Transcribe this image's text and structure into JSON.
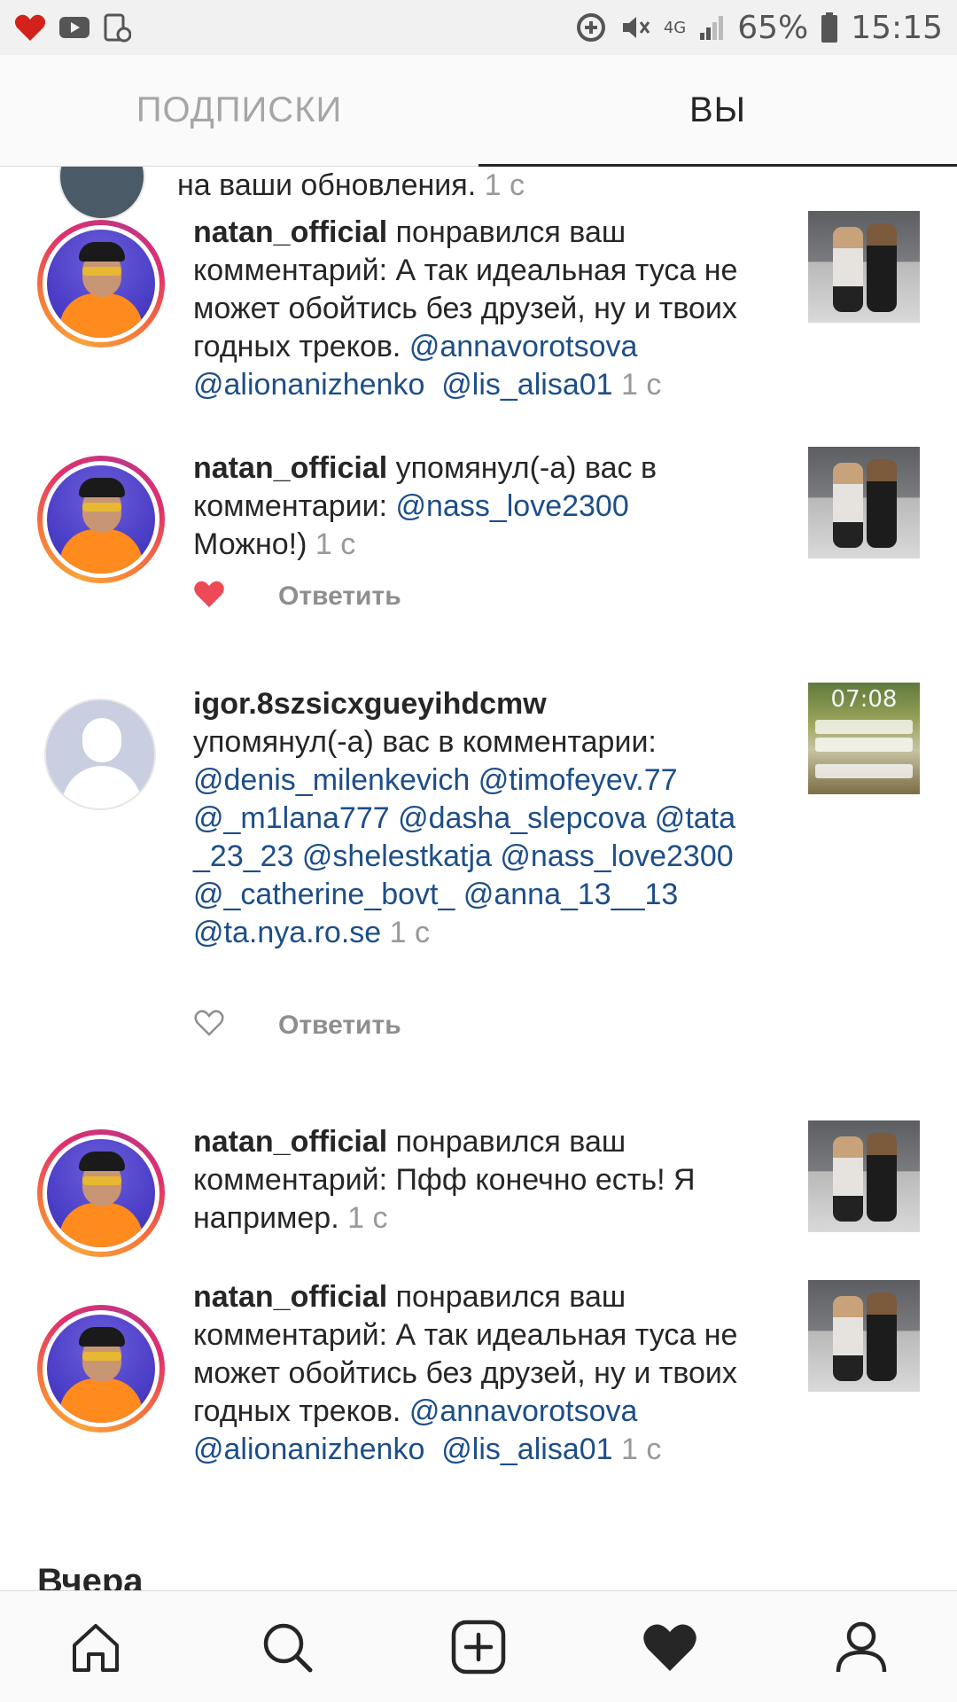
{
  "status_bar": {
    "battery": "65%",
    "time": "15:15",
    "network": "4G",
    "icons": [
      "heart-icon",
      "youtube-icon",
      "clipboard-icon",
      "data-saver-icon",
      "mute-icon",
      "signal-icon",
      "battery-icon"
    ]
  },
  "tabs": {
    "following": "ПОДПИСКИ",
    "you": "ВЫ",
    "active": "you"
  },
  "partial_top": {
    "text": "на ваши обновления.",
    "time": "1 с"
  },
  "items": [
    {
      "username": "natan_official",
      "action": " понравился ваш комментарий: А так идеальная туса не может обойтись без друзей, ну и твоих годных треков. ",
      "mention1": "@annavorotsova",
      "mention2": "@alionanizhenko",
      "mention3": "@lis_alisa01",
      "time": "1 с"
    },
    {
      "username": "natan_official",
      "action": " упомянул(-а) вас в комментарии: ",
      "mention1": "@nass_love2300",
      "after": "Можно!)",
      "time": "1 с",
      "reply": "Ответить",
      "liked": true
    },
    {
      "username": "igor.8szsicxgueyihdcmw",
      "action": "упомянул(-а) вас в комментарии:",
      "mentions_line1": "@denis_milenkevich @timofeyev.77",
      "mentions_line2": "@_m1lana777 @dasha_slepcova @tata",
      "mentions_line3": "_23_23 @shelestkatja @nass_love2300",
      "mentions_line4": "@_catherine_bovt_ @anna_13__13",
      "mentions_line5": "@ta.nya.ro.se",
      "time": "1 с",
      "reply": "Ответить",
      "liked": false,
      "thumb_clock": "07:08"
    },
    {
      "username": "natan_official",
      "action": " понравился ваш комментарий: Пфф конечно есть! Я например. ",
      "time": "1 с"
    },
    {
      "username": "natan_official",
      "action": " понравился ваш комментарий: А так идеальная туса не может обойтись без друзей, ну и твоих годных треков. ",
      "mention1": "@annavorotsova",
      "mention2": "@alionanizhenko",
      "mention3": "@lis_alisa01",
      "time": "1 с"
    }
  ],
  "section_yesterday": "Вчера",
  "bottom_nav": [
    "home-icon",
    "search-icon",
    "add-post-icon",
    "activity-heart-icon",
    "profile-icon"
  ],
  "colors": {
    "mention": "#1d4e89",
    "like_red": "#ed4956",
    "muted": "#999999"
  }
}
